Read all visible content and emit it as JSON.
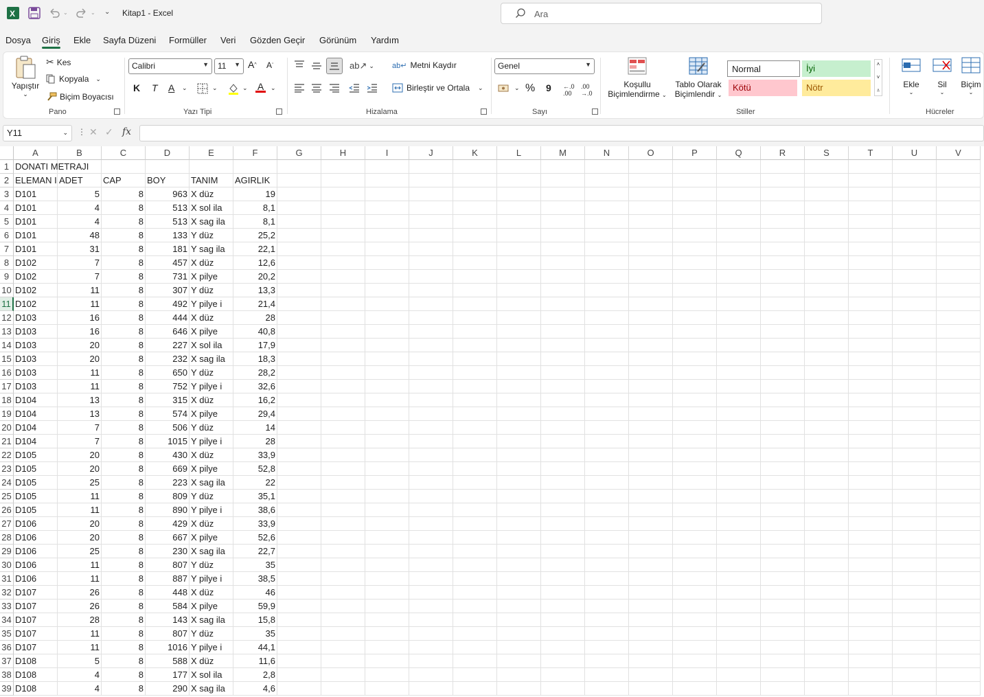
{
  "app": {
    "title": "Kitap1 - Excel",
    "search_placeholder": "Ara",
    "brand_color": "#1e7145"
  },
  "menu": [
    "Dosya",
    "Giriş",
    "Ekle",
    "Sayfa Düzeni",
    "Formüller",
    "Veri",
    "Gözden Geçir",
    "Görünüm",
    "Yardım"
  ],
  "ribbon": {
    "clipboard": {
      "paste": "Yapıştır",
      "cut": "Kes",
      "copy": "Kopyala",
      "format_painter": "Biçim Boyacısı",
      "label": "Pano"
    },
    "font": {
      "name": "Calibri",
      "size": "11",
      "bold": "K",
      "italic": "T",
      "underline": "A",
      "label": "Yazı Tipi"
    },
    "alignment": {
      "wrap": "Metni Kaydır",
      "merge": "Birleştir ve Ortala",
      "label": "Hizalama"
    },
    "number": {
      "format": "Genel",
      "percent": "%",
      "comma": "9",
      "label": "Sayı"
    },
    "styles": {
      "conditional_1": "Koşullu",
      "conditional_2": "Biçimlendirme",
      "table_1": "Tablo Olarak",
      "table_2": "Biçimlendir",
      "normal": "Normal",
      "good": "İyi",
      "bad": "Kötü",
      "neutral": "Nötr",
      "label": "Stiller"
    },
    "cells": {
      "insert": "Ekle",
      "delete": "Sil",
      "format": "Biçim",
      "label": "Hücreler"
    }
  },
  "formula_bar": {
    "name_box": "Y11",
    "fx": "fx",
    "value": ""
  },
  "columns": [
    "A",
    "B",
    "C",
    "D",
    "E",
    "F",
    "G",
    "H",
    "I",
    "J",
    "K",
    "L",
    "M",
    "N",
    "O",
    "P",
    "Q",
    "R",
    "S",
    "T",
    "U",
    "V"
  ],
  "selected_row": 11,
  "rows": [
    [
      "DONATI METRAJI",
      "",
      "",
      "",
      "",
      ""
    ],
    [
      "ELEMAN I:",
      "ADET",
      "CAP",
      "BOY",
      "TANIM",
      "AGIRLIK"
    ],
    [
      "D101",
      "5",
      "8",
      "963",
      "X düz",
      "19"
    ],
    [
      "D101",
      "4",
      "8",
      "513",
      "X sol ila",
      "8,1"
    ],
    [
      "D101",
      "4",
      "8",
      "513",
      "X sag ila",
      "8,1"
    ],
    [
      "D101",
      "48",
      "8",
      "133",
      "Y düz",
      "25,2"
    ],
    [
      "D101",
      "31",
      "8",
      "181",
      "Y sag ila",
      "22,1"
    ],
    [
      "D102",
      "7",
      "8",
      "457",
      "X düz",
      "12,6"
    ],
    [
      "D102",
      "7",
      "8",
      "731",
      "X pilye",
      "20,2"
    ],
    [
      "D102",
      "11",
      "8",
      "307",
      "Y düz",
      "13,3"
    ],
    [
      "D102",
      "11",
      "8",
      "492",
      "Y pilye  i",
      "21,4"
    ],
    [
      "D103",
      "16",
      "8",
      "444",
      "X düz",
      "28"
    ],
    [
      "D103",
      "16",
      "8",
      "646",
      "X pilye",
      "40,8"
    ],
    [
      "D103",
      "20",
      "8",
      "227",
      "X sol ila",
      "17,9"
    ],
    [
      "D103",
      "20",
      "8",
      "232",
      "X sag ila",
      "18,3"
    ],
    [
      "D103",
      "11",
      "8",
      "650",
      "Y düz",
      "28,2"
    ],
    [
      "D103",
      "11",
      "8",
      "752",
      "Y pilye  i",
      "32,6"
    ],
    [
      "D104",
      "13",
      "8",
      "315",
      "X düz",
      "16,2"
    ],
    [
      "D104",
      "13",
      "8",
      "574",
      "X pilye",
      "29,4"
    ],
    [
      "D104",
      "7",
      "8",
      "506",
      "Y düz",
      "14"
    ],
    [
      "D104",
      "7",
      "8",
      "1015",
      "Y pilye  i",
      "28"
    ],
    [
      "D105",
      "20",
      "8",
      "430",
      "X düz",
      "33,9"
    ],
    [
      "D105",
      "20",
      "8",
      "669",
      "X pilye",
      "52,8"
    ],
    [
      "D105",
      "25",
      "8",
      "223",
      "X sag ila",
      "22"
    ],
    [
      "D105",
      "11",
      "8",
      "809",
      "Y düz",
      "35,1"
    ],
    [
      "D105",
      "11",
      "8",
      "890",
      "Y pilye  i",
      "38,6"
    ],
    [
      "D106",
      "20",
      "8",
      "429",
      "X düz",
      "33,9"
    ],
    [
      "D106",
      "20",
      "8",
      "667",
      "X pilye",
      "52,6"
    ],
    [
      "D106",
      "25",
      "8",
      "230",
      "X sag ila",
      "22,7"
    ],
    [
      "D106",
      "11",
      "8",
      "807",
      "Y düz",
      "35"
    ],
    [
      "D106",
      "11",
      "8",
      "887",
      "Y pilye  i",
      "38,5"
    ],
    [
      "D107",
      "26",
      "8",
      "448",
      "X düz",
      "46"
    ],
    [
      "D107",
      "26",
      "8",
      "584",
      "X pilye",
      "59,9"
    ],
    [
      "D107",
      "28",
      "8",
      "143",
      "X sag ila",
      "15,8"
    ],
    [
      "D107",
      "11",
      "8",
      "807",
      "Y düz",
      "35"
    ],
    [
      "D107",
      "11",
      "8",
      "1016",
      "Y pilye  i",
      "44,1"
    ],
    [
      "D108",
      "5",
      "8",
      "588",
      "X düz",
      "11,6"
    ],
    [
      "D108",
      "4",
      "8",
      "177",
      "X sol ila",
      "2,8"
    ],
    [
      "D108",
      "4",
      "8",
      "290",
      "X sag ila",
      "4,6"
    ]
  ]
}
